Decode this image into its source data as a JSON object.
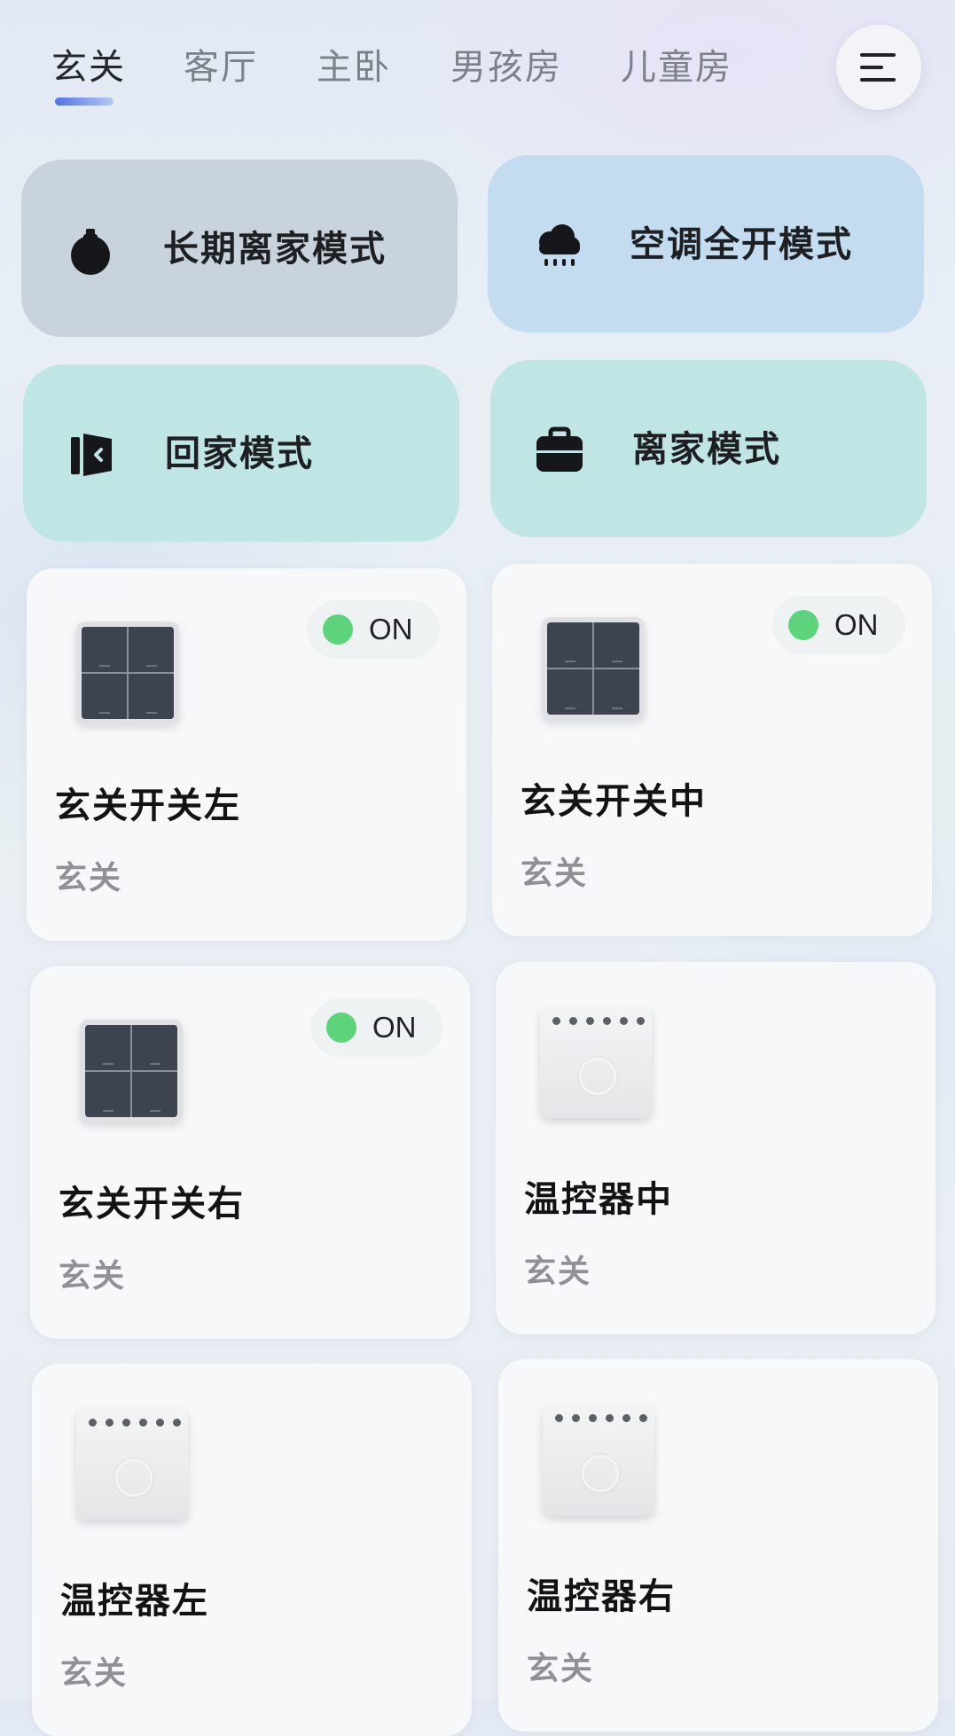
{
  "tabs": [
    {
      "label": "玄关",
      "active": true
    },
    {
      "label": "客厅",
      "active": false
    },
    {
      "label": "主卧",
      "active": false
    },
    {
      "label": "男孩房",
      "active": false
    },
    {
      "label": "儿童房",
      "active": false
    }
  ],
  "menu": {
    "icon": "menu-icon"
  },
  "scenes": [
    {
      "label": "长期离家模式",
      "icon": "bell-icon",
      "color": "#c9d3dd"
    },
    {
      "label": "空调全开模式",
      "icon": "cloud-rain-icon",
      "color": "#c4dcef"
    },
    {
      "label": "回家模式",
      "icon": "door-enter-icon",
      "color": "#bfe5e5"
    },
    {
      "label": "离家模式",
      "icon": "briefcase-icon",
      "color": "#bfe5e5"
    }
  ],
  "devices": [
    {
      "name": "玄关开关左",
      "room": "玄关",
      "type": "switch-panel",
      "status": "ON"
    },
    {
      "name": "玄关开关中",
      "room": "玄关",
      "type": "switch-panel",
      "status": "ON"
    },
    {
      "name": "玄关开关右",
      "room": "玄关",
      "type": "switch-panel",
      "status": "ON"
    },
    {
      "name": "温控器中",
      "room": "玄关",
      "type": "thermostat"
    },
    {
      "name": "温控器左",
      "room": "玄关",
      "type": "thermostat"
    },
    {
      "name": "温控器右",
      "room": "玄关",
      "type": "thermostat"
    }
  ],
  "colors": {
    "status_on": "#5dd47b",
    "tab_active_indicator": "#4f73e0",
    "card_background": "#f7f8f9"
  }
}
